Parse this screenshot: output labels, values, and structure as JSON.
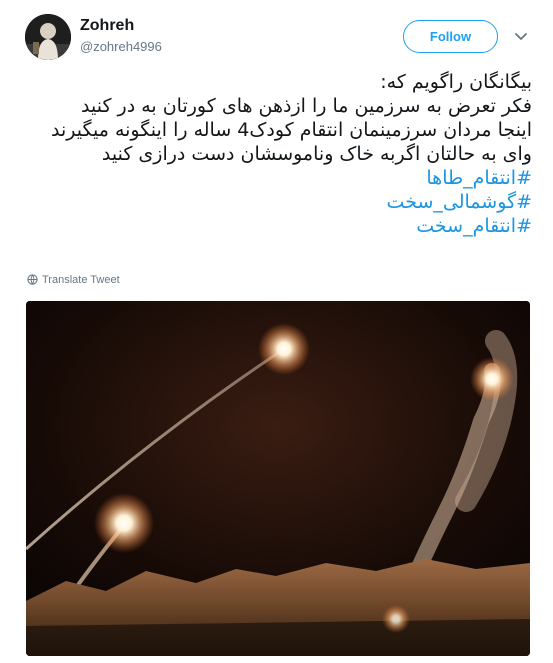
{
  "user": {
    "name": "Zohreh",
    "handle": "@zohreh4996"
  },
  "actions": {
    "follow_label": "Follow"
  },
  "tweet": {
    "lines": [
      "بیگانگان راگویم که:",
      "فکر تعرض به سرزمین ما را ازذهن های کورتان به در کنید",
      "اینجا مردان سرزمینمان انتقام کودک4 ساله را اینگونه میگیرند",
      "وای به حالتان اگربه خاک وناموسشان دست درازی کنید"
    ],
    "hashtags": [
      "#انتقام_طاها",
      "#گوشمالی_سخت",
      "#انتقام_سخت"
    ]
  },
  "translate": {
    "label": "Translate Tweet"
  },
  "icons": {
    "caret": "chevron-down-icon",
    "globe": "globe-icon"
  },
  "colors": {
    "accent": "#1da1f2",
    "hashtag": "#1b95e0",
    "muted": "#657786"
  }
}
